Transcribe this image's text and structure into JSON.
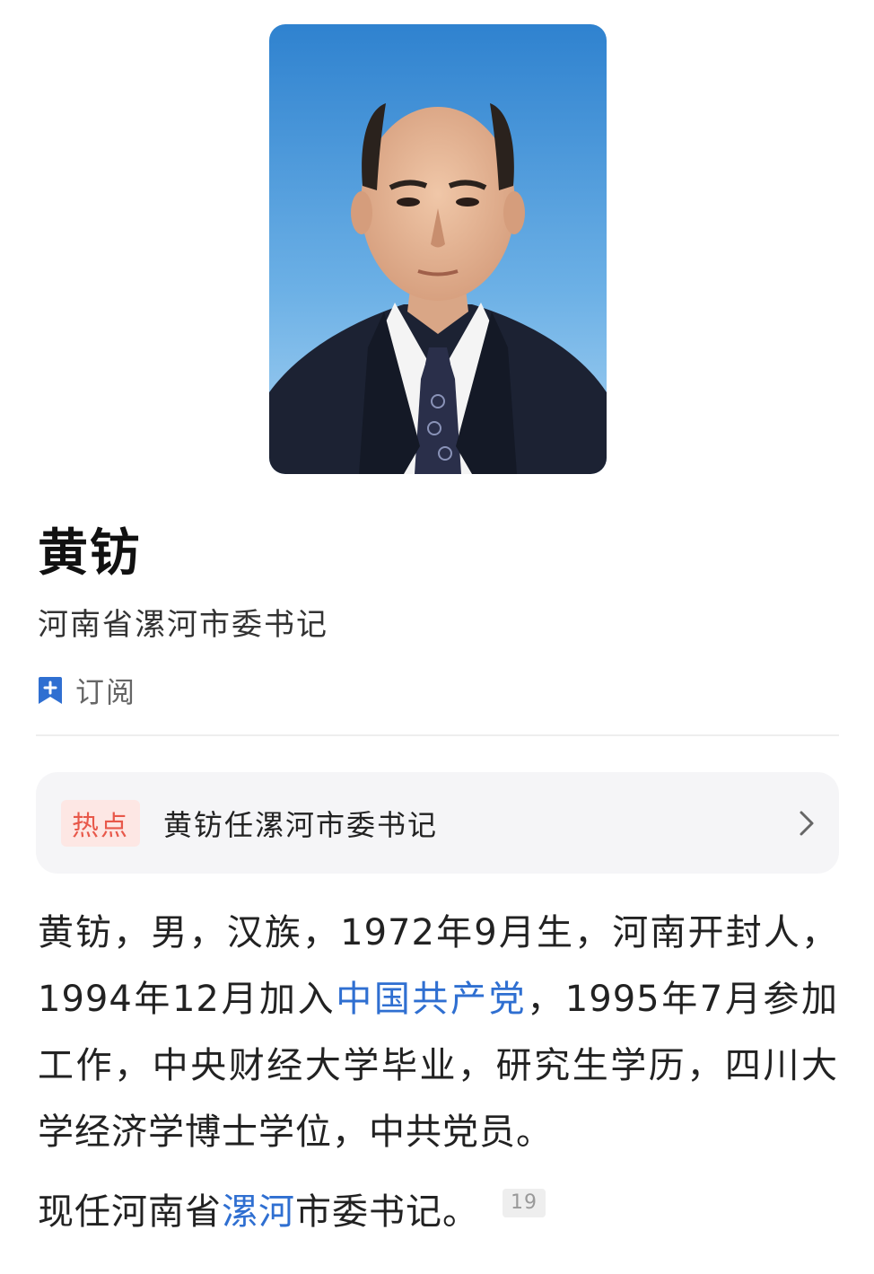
{
  "profile": {
    "photo_alt": "portrait",
    "name": "黄钫",
    "title": "河南省漯河市委书记"
  },
  "subscribe": {
    "label": "订阅",
    "icon": "bookmark-plus-icon"
  },
  "hot_topic": {
    "badge": "热点",
    "title": "黄钫任漯河市委书记",
    "icon": "chevron-right-icon"
  },
  "bio": {
    "part1": "黄钫，男，汉族，1972年9月生，河南开封人，1994年12月加入",
    "link1": "中国共产党",
    "part2": "，1995年7月参加工作，中央财经大学毕业，研究生学历，四川大学经济学博士学位，中共党员。"
  },
  "current": {
    "prefix": "现任河南省",
    "link": "漯河",
    "suffix": "市委书记。",
    "reference": "19"
  },
  "colors": {
    "accent": "#2f6fd1",
    "hot_badge_text": "#e8584a",
    "hot_badge_bg": "#fde7e4",
    "card_bg": "#f5f5f7"
  }
}
